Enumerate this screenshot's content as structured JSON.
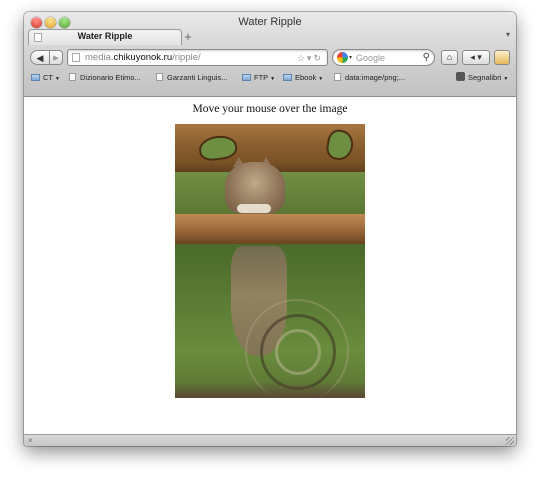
{
  "window": {
    "title": "Water Ripple"
  },
  "tabs": [
    {
      "label": "Water Ripple",
      "active": true
    }
  ],
  "new_tab_label": "+",
  "toolbar": {
    "back_icon": "back-arrow-icon",
    "forward_icon": "forward-arrow-icon",
    "url_prefix": "media.",
    "url_host": "chikuyonok.ru",
    "url_path": "/ripple/",
    "search_placeholder": "Google",
    "home_icon": "home-icon",
    "history_icon": "history-icon",
    "theme_icon": "theme-icon"
  },
  "bookmarks": [
    {
      "label": "CT",
      "type": "folder"
    },
    {
      "label": "Dizionario Etimo...",
      "type": "page"
    },
    {
      "label": "Garzanti Linguis...",
      "type": "page"
    },
    {
      "label": "FTP",
      "type": "folder"
    },
    {
      "label": "Ebook",
      "type": "folder"
    },
    {
      "label": "data:image/png;...",
      "type": "page"
    },
    {
      "label": "Segnalibri",
      "type": "menu"
    }
  ],
  "page": {
    "caption": "Move your mouse over the image"
  },
  "statusbar": {
    "close_glyph": "×"
  },
  "colors": {
    "chrome": "#cfcfcf",
    "page_bg": "#ffffff"
  }
}
